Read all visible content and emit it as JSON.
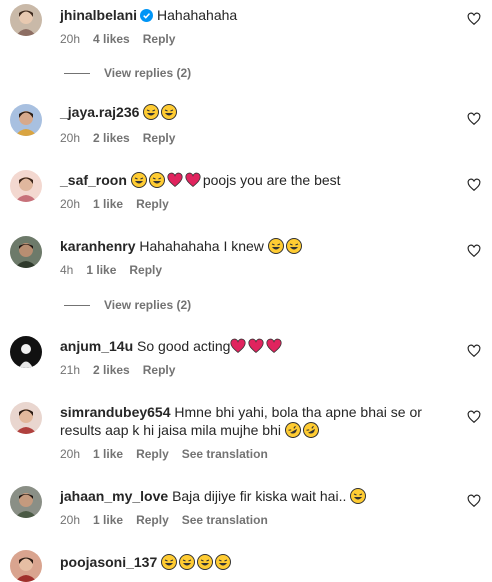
{
  "comments": [
    {
      "user": "jhinalbelani",
      "text": "Hahahahaha",
      "time": "20h",
      "likes": "4 likes",
      "reply": "Reply",
      "view_replies": "View replies (2)"
    },
    {
      "user": "_jaya.raj236",
      "text": "😂😂",
      "time": "20h",
      "likes": "2 likes",
      "reply": "Reply"
    },
    {
      "user": "_saf_roon",
      "text": "😂😂❤️❤️poojs you are the best",
      "time": "20h",
      "likes": "1 like",
      "reply": "Reply"
    },
    {
      "user": "karanhenry",
      "text": "Hahahahaha I knew 😂😂",
      "time": "4h",
      "likes": "1 like",
      "reply": "Reply",
      "view_replies": "View replies (2)"
    },
    {
      "user": "anjum_14u",
      "text": "So good acting❤️❤️❤️",
      "time": "21h",
      "likes": "2 likes",
      "reply": "Reply"
    },
    {
      "user": "simrandubey654",
      "text": "Hmne bhi yahi, bola tha apne bhai se or",
      "text2": "results aap k hi jaisa mila mujhe bhi 🤣🤣",
      "time": "20h",
      "likes": "1 like",
      "reply": "Reply",
      "translation": "See translation"
    },
    {
      "user": "jahaan_my_love",
      "text": "Baja dijiye fir kiska wait hai.. 😂",
      "time": "20h",
      "likes": "1 like",
      "reply": "Reply",
      "translation": "See translation"
    },
    {
      "user": "poojasoni_137",
      "text": "😂😂😂😂"
    }
  ],
  "colors": {
    "text": "#262626",
    "secondary": "#737373",
    "verified": "#0095f6",
    "heart_emoji": "#e0245e"
  }
}
